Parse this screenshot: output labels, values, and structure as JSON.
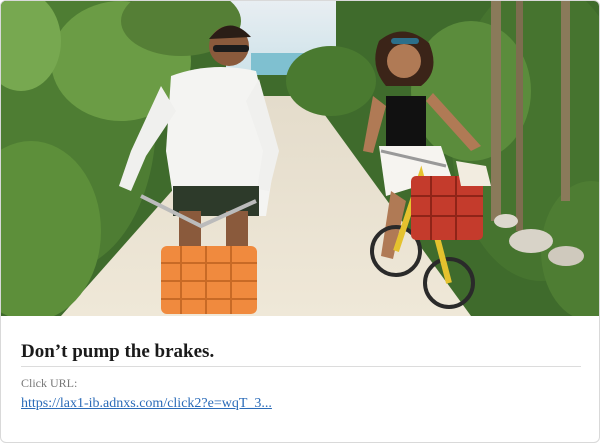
{
  "ad": {
    "headline": "Don’t pump the brakes.",
    "click_url_label": "Click URL:",
    "click_url": "https://lax1-ib.adnxs.com/click2?e=wqT_3...",
    "image_description_icon": "photo-couple-bicycles"
  }
}
